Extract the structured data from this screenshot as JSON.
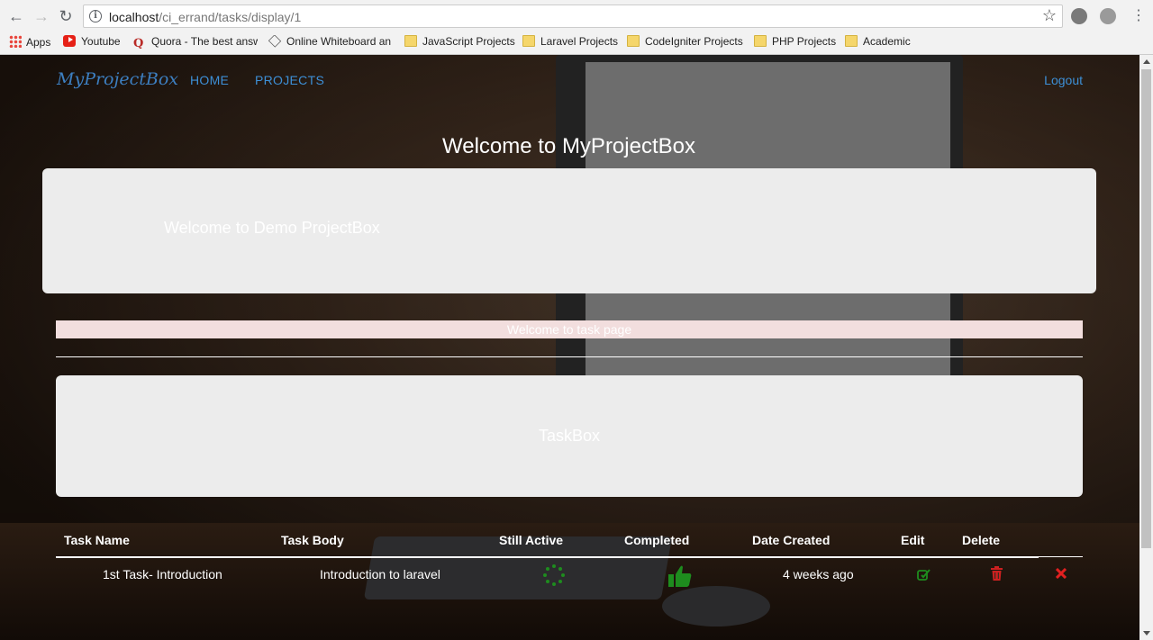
{
  "browser": {
    "url_host": "localhost",
    "url_path": "/ci_errand/tasks/display/1",
    "bookmarks": [
      {
        "label": "Apps",
        "icon": "apps-grid-icon"
      },
      {
        "label": "Youtube",
        "icon": "youtube-icon"
      },
      {
        "label": "Quora - The best answ",
        "icon": "quora-icon"
      },
      {
        "label": "Online Whiteboard an",
        "icon": "whiteboard-icon"
      },
      {
        "label": "JavaScript Projects",
        "icon": "folder-icon"
      },
      {
        "label": "Laravel Projects",
        "icon": "folder-icon"
      },
      {
        "label": "CodeIgniter Projects",
        "icon": "folder-icon"
      },
      {
        "label": "PHP Projects",
        "icon": "folder-icon"
      },
      {
        "label": "Academic",
        "icon": "folder-icon"
      }
    ]
  },
  "navbar": {
    "brand": "MyProjectBox",
    "links": [
      "HOME",
      "PROJECTS"
    ],
    "logout": "Logout"
  },
  "main": {
    "title": "Welcome to MyProjectBox",
    "jumbotron": "Welcome to Demo ProjectBox",
    "alert": "Welcome to task page",
    "taskbox": "TaskBox"
  },
  "table": {
    "headers": [
      "Task Name",
      "Task Body",
      "Still Active",
      "Completed",
      "Date Created",
      "Edit",
      "Delete"
    ],
    "rows": [
      {
        "name": "1st Task- Introduction",
        "body": "Introduction to laravel",
        "still_active_icon": "spinner-icon",
        "completed_icon": "thumbs-up-icon",
        "date": "4 weeks ago",
        "edit_icon": "edit-icon",
        "delete_icon": "trash-icon",
        "extra_icon": "close-icon"
      }
    ]
  },
  "colors": {
    "link": "#3d8fd6",
    "success": "#1e8c1e",
    "danger": "#cc2020"
  }
}
